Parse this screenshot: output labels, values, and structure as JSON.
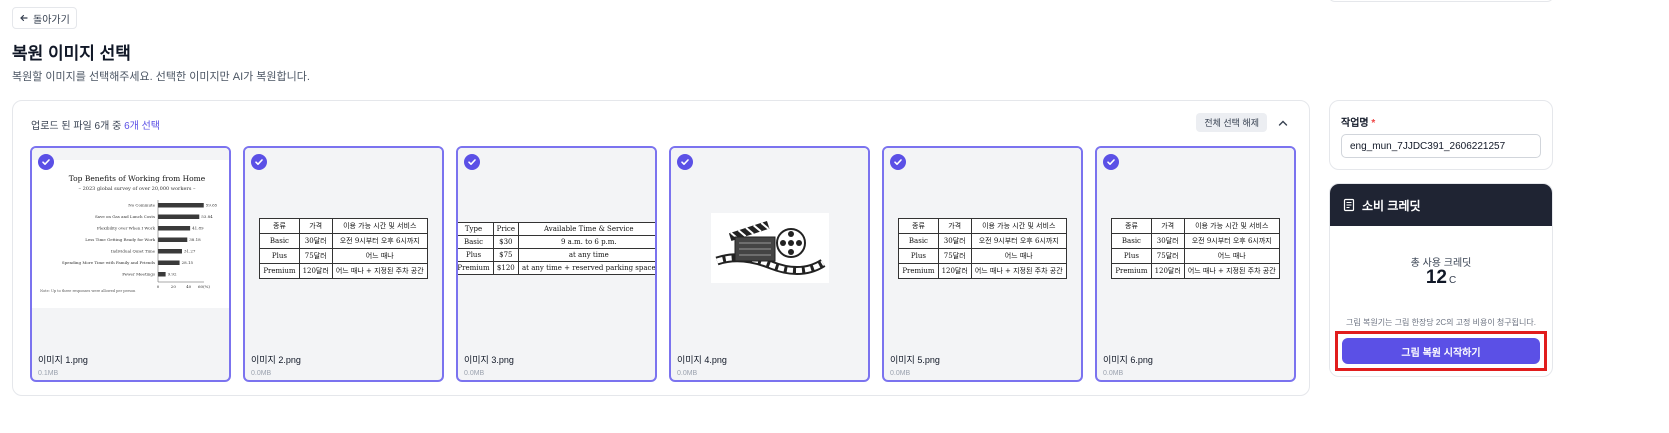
{
  "header": {
    "back_label": "돌아가기",
    "title": "복원 이미지 선택",
    "subtitle": "복원할 이미지를 선택해주세요. 선택한 이미지만 AI가 복원합니다."
  },
  "selection": {
    "summary_prefix": "업로드 된 파일 6개 중 ",
    "summary_count": "6개 선택",
    "deselect_label": "전체 선택 해제"
  },
  "cards": [
    {
      "name": "이미지 1.png",
      "size": "0.1MB",
      "selected": true
    },
    {
      "name": "이미지 2.png",
      "size": "0.0MB",
      "selected": true
    },
    {
      "name": "이미지 3.png",
      "size": "0.0MB",
      "selected": true
    },
    {
      "name": "이미지 4.png",
      "size": "0.0MB",
      "selected": true
    },
    {
      "name": "이미지 5.png",
      "size": "0.0MB",
      "selected": true
    },
    {
      "name": "이미지 6.png",
      "size": "0.0MB",
      "selected": true
    }
  ],
  "thumb1": {
    "title": "Top Benefits of Working from Home",
    "subtitle": "– 2023 global survey of over 20,000 workers –",
    "bars": [
      {
        "label": "No Commute",
        "value": "59.65",
        "v": 59.65
      },
      {
        "label": "Save on Gas and Lunch Costs",
        "value": "53.84",
        "v": 53.84
      },
      {
        "label": "Flexibility over When I Work",
        "value": "41.89",
        "v": 41.89
      },
      {
        "label": "Less Time Getting Ready for Work",
        "value": "38.18",
        "v": 38.18
      },
      {
        "label": "Individual Quiet Time",
        "value": "31.27",
        "v": 31.27
      },
      {
        "label": "Spending More Time with Family and Friends",
        "value": "28.15",
        "v": 28.15
      },
      {
        "label": "Fewer Meetings",
        "value": "9.92",
        "v": 9.92
      }
    ],
    "ticks": [
      "0",
      "20",
      "40",
      "60(%)"
    ],
    "note": "Note: Up to three responses were allowed per person"
  },
  "kor_table": {
    "headers": [
      "종류",
      "가격",
      "이용 가능 시간 및 서비스"
    ],
    "rows": [
      [
        "Basic",
        "30달러",
        "오전 9시부터 오후 6시까지"
      ],
      [
        "Plus",
        "75달러",
        "어느 때나"
      ],
      [
        "Premium",
        "120달러",
        "어느 때나 + 지정된 주차 공간"
      ]
    ]
  },
  "eng_table": {
    "headers": [
      "Type",
      "Price",
      "Available Time & Service"
    ],
    "rows": [
      [
        "Basic",
        "$30",
        "9 a.m. to 6 p.m."
      ],
      [
        "Plus",
        "$75",
        "at any time"
      ],
      [
        "Premium",
        "$120",
        "at any time + reserved parking space"
      ]
    ]
  },
  "job": {
    "label": "작업명",
    "required_mark": "*",
    "value": "eng_mun_7JJDC391_2606221257"
  },
  "credit": {
    "title": "소비 크레딧",
    "total_label": "총 사용 크레딧",
    "total_value": "12",
    "unit": "C",
    "note": "그림 복원기는 그림 한장당 2C의 고정 비용이 청구됩니다.",
    "start_label": "그림 복원 시작하기"
  },
  "colors": {
    "accent": "#5b50e6",
    "card_border": "#7b73ef",
    "highlight": "#e11d1d",
    "credit_header": "#1f2433"
  }
}
